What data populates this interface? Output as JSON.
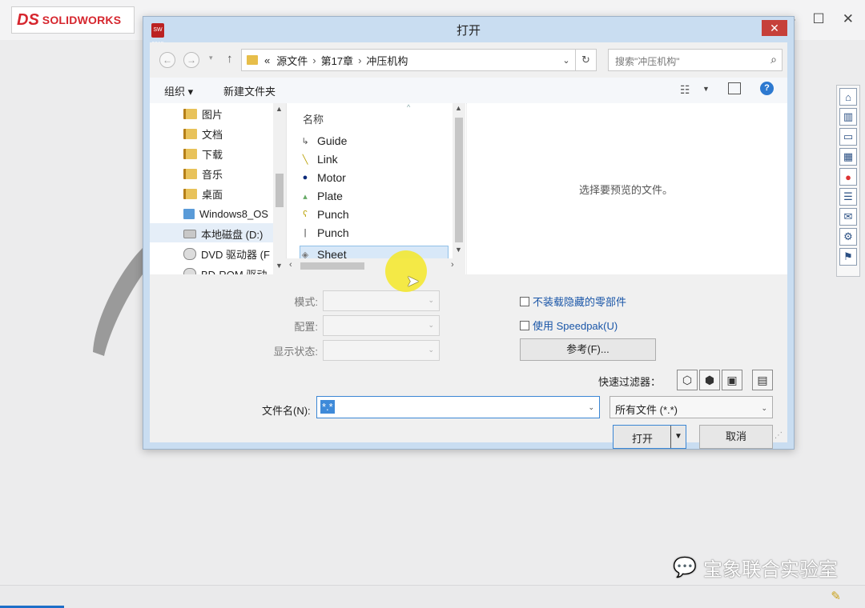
{
  "app": {
    "logo_mark": "DS",
    "logo_text": "SOLIDWORKS",
    "win_minimize": "—",
    "win_maximize": "☐",
    "win_close": "✕"
  },
  "right_toolbar": {
    "icons": [
      "home-icon",
      "parts-3d-icon",
      "folder-open-icon",
      "view-palette-icon",
      "appearances-icon",
      "custom-properties-icon",
      "forum-icon",
      "design-library-icon",
      "solidworks-resources-icon"
    ]
  },
  "watermark": {
    "text": "宝象联合实验室"
  },
  "dialog": {
    "title": "打开",
    "close": "✕",
    "app_icon_text": "SW 2015",
    "address": {
      "overflow": "«",
      "crumbs": [
        "源文件",
        "第17章",
        "冲压机构"
      ]
    },
    "search_placeholder": "搜索\"冲压机构\"",
    "toolbar": {
      "organize": "组织 ▾",
      "new_folder": "新建文件夹"
    },
    "nav_items": [
      "图片",
      "文档",
      "下载",
      "音乐",
      "桌面",
      "Windows8_OS",
      "本地磁盘 (D:)",
      "DVD 驱动器 (F",
      "BD-ROM 驱动"
    ],
    "file_list": {
      "column_name": "名称",
      "files": [
        "Guide",
        "Link",
        "Motor",
        "Plate",
        "Punch",
        "Punch",
        "Sheet"
      ],
      "selected": "Sheet"
    },
    "preview_text": "选择要预览的文件。",
    "options": {
      "mode_label": "模式:",
      "config_label": "配置:",
      "display_state_label": "显示状态:",
      "hide_components": "不装载隐藏的零部件",
      "speedpak": "使用 Speedpak(U)",
      "references_button": "参考(F)..."
    },
    "quick_filter_label": "快速过滤器：",
    "filename_label": "文件名(N):",
    "filename_value": "*.*",
    "filetype_value": "所有文件 (*.*)",
    "open_button": "打开",
    "cancel_button": "取消"
  }
}
